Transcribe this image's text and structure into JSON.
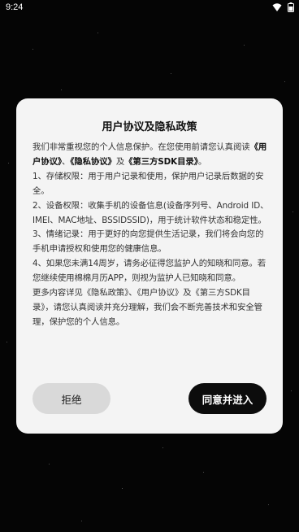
{
  "status_bar": {
    "time": "9:24"
  },
  "dialog": {
    "title": "用户协议及隐私政策",
    "intro_text": "我们非常重视您的个人信息保护。在您使用前请您认真阅读",
    "intro_link_user": "《用户协议》",
    "intro_sep1": "、",
    "intro_link_privacy": "《隐私协议》",
    "intro_and": "及",
    "intro_link_sdk": "《第三方SDK目录》",
    "intro_end": "。",
    "item1": "1、存储权限：用于用户记录和使用，保护用户记录后数据的安全。",
    "item2": "2、设备权限：收集手机的设备信息(设备序列号、Android ID、IMEI、MAC地址、BSSIDSSID)，用于统计软件状态和稳定性。",
    "item3": "3、情绪记录：用于更好的向您提供生活记录，我们将会向您的手机申请授权和使用您的健康信息。",
    "item4": "4、如果您未满14周岁，请务必征得您监护人的知晓和同意。若您继续使用棉棉月历APP，则视为监护人已知晓和同意。",
    "outro": "更多内容详见《隐私政策》、《用户协议》及《第三方SDK目录》，请您认真阅读并充分理解，我们会不断完善技术和安全管理，保护您的个人信息。",
    "reject_label": "拒绝",
    "agree_label": "同意并进入"
  }
}
